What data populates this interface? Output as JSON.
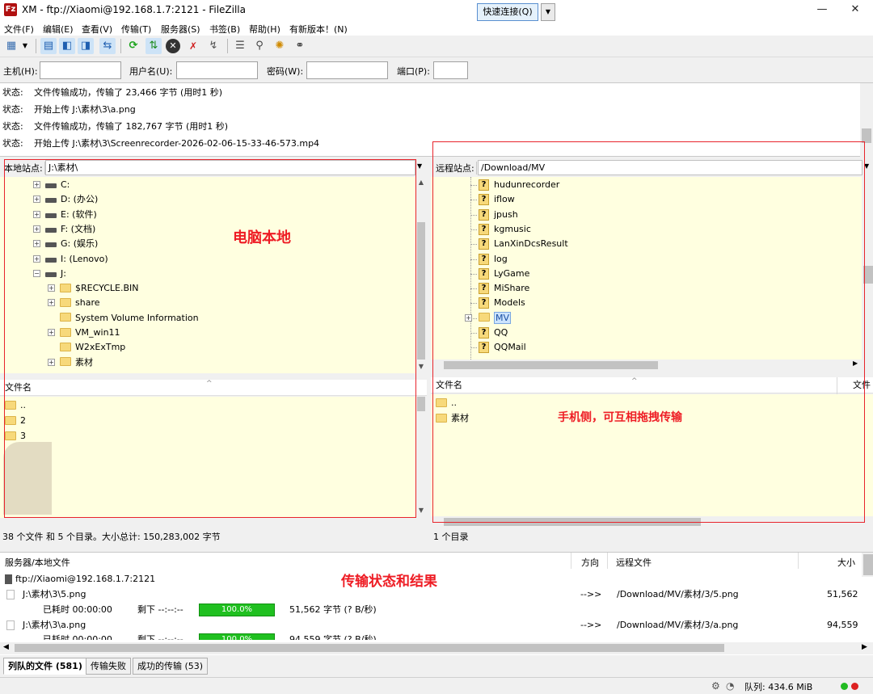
{
  "window": {
    "app_icon_label": "Fz",
    "title": "XM - ftp://Xiaomi@192.168.1.7:2121 - FileZilla",
    "minimize_glyph": "—",
    "maximize_glyph": "☐",
    "close_glyph": "✕"
  },
  "menu": [
    "文件(F)",
    "编辑(E)",
    "查看(V)",
    "传输(T)",
    "服务器(S)",
    "书签(B)",
    "帮助(H)",
    "有新版本！(N)"
  ],
  "toolbar": {
    "icons": [
      "site-manager-icon",
      "dropdown-arrow-icon",
      "message-log-toggle-icon",
      "local-tree-toggle-icon",
      "remote-tree-toggle-icon",
      "transfer-queue-toggle-icon",
      "refresh-icon",
      "process-queue-icon",
      "cancel-icon",
      "disconnect-icon",
      "reconnect-icon",
      "directory-filter-icon",
      "comparison-icon",
      "sync-browsing-icon",
      "search-remote-icon"
    ],
    "accent_green": "#1aa31a",
    "accent_blue": "#2f6fd6"
  },
  "quickconnect": {
    "host_label": "主机(H):",
    "user_label": "用户名(U):",
    "pass_label": "密码(W):",
    "port_label": "端口(P):",
    "host_value": "",
    "user_value": "",
    "pass_value": "",
    "port_value": "",
    "button_label": "快速连接(Q)",
    "dropdown_glyph": "▼"
  },
  "log": [
    {
      "label": "状态:",
      "text": "文件传输成功，传输了 23,466 字节 (用时1 秒)"
    },
    {
      "label": "状态:",
      "text": "开始上传 J:\\素材\\3\\a.png"
    },
    {
      "label": "状态:",
      "text": "文件传输成功，传输了 182,767 字节 (用时1 秒)"
    },
    {
      "label": "状态:",
      "text": "开始上传 J:\\素材\\3\\Screenrecorder-2026-02-06-15-33-46-573.mp4"
    }
  ],
  "local": {
    "path_label": "本地站点:",
    "path": "J:\\素材\\",
    "tree": [
      {
        "label": "C:",
        "icon": "drive",
        "level": 0,
        "expander": "+"
      },
      {
        "label": "D: (办公)",
        "icon": "drive",
        "level": 0,
        "expander": "+"
      },
      {
        "label": "E: (软件)",
        "icon": "drive",
        "level": 0,
        "expander": "+"
      },
      {
        "label": "F: (文档)",
        "icon": "drive",
        "level": 0,
        "expander": "+"
      },
      {
        "label": "G: (娱乐)",
        "icon": "drive",
        "level": 0,
        "expander": "+"
      },
      {
        "label": "I: (Lenovo)",
        "icon": "drive",
        "level": 0,
        "expander": "+"
      },
      {
        "label": "J:",
        "icon": "drive",
        "level": 0,
        "expander": "−"
      },
      {
        "label": "$RECYCLE.BIN",
        "icon": "folder",
        "level": 1,
        "expander": "+"
      },
      {
        "label": "share",
        "icon": "folder",
        "level": 1,
        "expander": "+"
      },
      {
        "label": "System Volume Information",
        "icon": "folder",
        "level": 1,
        "expander": ""
      },
      {
        "label": "VM_win11",
        "icon": "folder",
        "level": 1,
        "expander": "+"
      },
      {
        "label": "W2xExTmp",
        "icon": "folder",
        "level": 1,
        "expander": ""
      },
      {
        "label": "素材",
        "icon": "folder",
        "level": 1,
        "expander": "+"
      }
    ],
    "list_header": "文件名",
    "files": [
      "..",
      "2",
      "3"
    ],
    "status": "38 个文件 和 5 个目录。大小总计: 150,283,002 字节",
    "annotation": "电脑本地"
  },
  "remote": {
    "path_label": "远程站点:",
    "path": "/Download/MV",
    "tree": [
      {
        "label": "hudunrecorder",
        "expander": ""
      },
      {
        "label": "iflow",
        "expander": ""
      },
      {
        "label": "jpush",
        "expander": ""
      },
      {
        "label": "kgmusic",
        "expander": ""
      },
      {
        "label": "LanXinDcsResult",
        "expander": ""
      },
      {
        "label": "log",
        "expander": ""
      },
      {
        "label": "LyGame",
        "expander": ""
      },
      {
        "label": "MiShare",
        "expander": ""
      },
      {
        "label": "Models",
        "expander": ""
      },
      {
        "label": "MV",
        "expander": "+",
        "selected": true
      },
      {
        "label": "QQ",
        "expander": ""
      },
      {
        "label": "QQMail",
        "expander": ""
      }
    ],
    "list_header": "文件名",
    "list_header2": "文件大",
    "files": [
      "..",
      "素材"
    ],
    "status": "1 个目录",
    "annotation": "手机侧，可互相拖拽传输"
  },
  "queue": {
    "headers": {
      "server": "服务器/本地文件",
      "direction": "方向",
      "remote": "远程文件",
      "size": "大小"
    },
    "server": "ftp://Xiaomi@192.168.1.7:2121",
    "items": [
      {
        "local": "J:\\素材\\3\\5.png",
        "direction": "-->>",
        "remote": "/Download/MV/素材/3/5.png",
        "size": "51,562",
        "elapsed": "已耗时 00:00:00",
        "left": "剩下 --:--:--",
        "progress": "100.0%",
        "speed": "51,562 字节 (? B/秒)"
      },
      {
        "local": "J:\\素材\\3\\a.png",
        "direction": "-->>",
        "remote": "/Download/MV/素材/3/a.png",
        "size": "94,559",
        "elapsed": "已耗时 00:00:00",
        "left": "剩下 --:--:--",
        "progress": "100.0%",
        "speed": "94,559 字节 (? B/秒)"
      }
    ],
    "annotation": "传输状态和结果",
    "progress_color": "#20c020"
  },
  "tabs": [
    "列队的文件 (581)",
    "传输失败",
    "成功的传输 (53)"
  ],
  "statusbar": {
    "queue": "队列: 434.6 MiB",
    "led_green": "#22bb22",
    "led_red": "#dd2222"
  },
  "annotation_color": "#ee1c24"
}
